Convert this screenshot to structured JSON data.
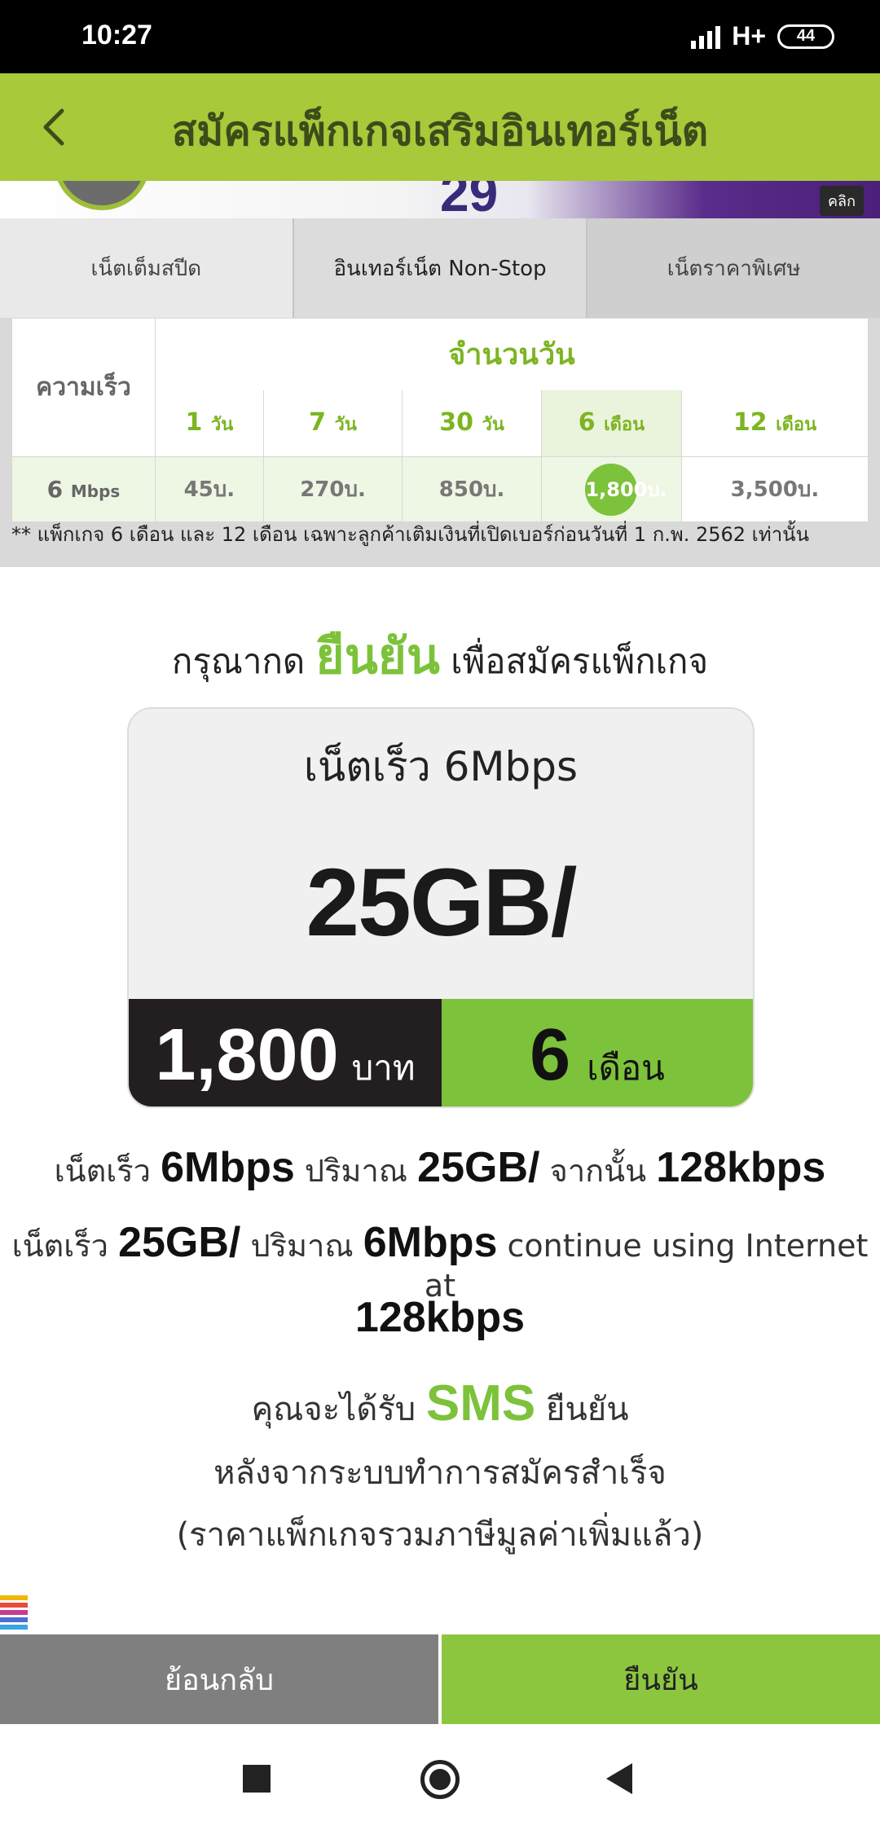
{
  "status_bar": {
    "time": "10:27",
    "network": "H+",
    "battery": "44"
  },
  "header": {
    "title": "สมัครแพ็กเกจเสริมอินเทอร์เน็ต"
  },
  "banner": {
    "number": "29",
    "click_label": "คลิก"
  },
  "tabs": [
    {
      "label": "เน็ตเต็มสปีด"
    },
    {
      "label": "อินเทอร์เน็ต Non-Stop"
    },
    {
      "label": "เน็ตราคาพิเศษ"
    }
  ],
  "rate_table": {
    "speed_header": "ความเร็ว",
    "days_header": "จำนวนวัน",
    "options": [
      {
        "num": "1",
        "unit": "วัน"
      },
      {
        "num": "7",
        "unit": "วัน"
      },
      {
        "num": "30",
        "unit": "วัน"
      },
      {
        "num": "6",
        "unit": "เดือน"
      },
      {
        "num": "12",
        "unit": "เดือน"
      }
    ],
    "speed_value": "6",
    "speed_unit": "Mbps",
    "prices": [
      "45บ.",
      "270บ.",
      "850บ.",
      "1,800บ.",
      "3,500บ."
    ],
    "selected_index": 3,
    "note": "** แพ็กเกจ 6 เดือน และ 12 เดือน เฉพาะลูกค้าเติมเงินที่เปิดเบอร์ก่อนวันที่ 1 ก.พ. 2562 เท่านั้น"
  },
  "prompt": {
    "before": "กรุณากด",
    "highlight": "ยืนยัน",
    "after": "เพื่อสมัครแพ็กเกจ"
  },
  "package_card": {
    "title": "เน็ตเร็ว 6Mbps",
    "quota": "25GB/",
    "price": "1,800",
    "price_unit": "บาท",
    "duration": "6",
    "duration_unit": "เดือน"
  },
  "descriptions": {
    "line1": {
      "a": "เน็ตเร็ว",
      "b": "6Mbps",
      "c": "ปริมาณ",
      "d": "25GB/",
      "e": "จากนั้น",
      "f": "128kbps"
    },
    "line2": {
      "a": "เน็ตเร็ว",
      "b": "25GB/",
      "c": "ปริมาณ",
      "d": "6Mbps",
      "e": "continue using Internet at"
    },
    "line3": "128kbps",
    "line4": {
      "a": "คุณจะได้รับ",
      "b": "SMS",
      "c": "ยืนยัน"
    },
    "line5": "หลังจากระบบทำการสมัครสำเร็จ",
    "line6": "(ราคาแพ็กเกจรวมภาษีมูลค่าเพิ่มแล้ว)"
  },
  "buttons": {
    "back": "ย้อนกลับ",
    "confirm": "ยืนยัน"
  },
  "colors": {
    "header_bg": "#a7c93a",
    "accent_green": "#7cc23a",
    "dark": "#231f20",
    "back_button": "#7f7f7f",
    "confirm_button": "#8cc63f"
  }
}
